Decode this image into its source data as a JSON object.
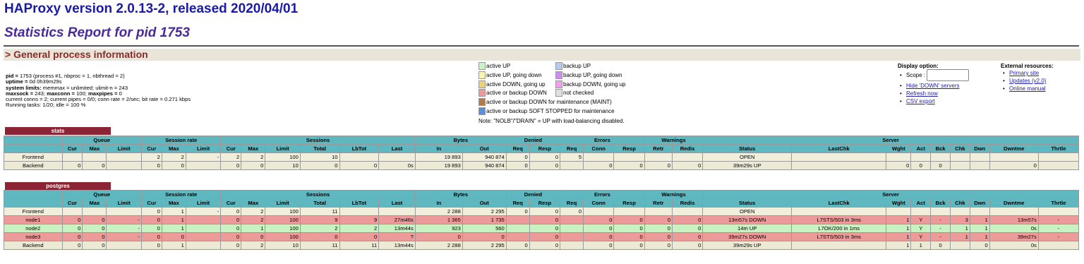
{
  "header": {
    "title": "HAProxy version 2.0.13-2, released 2020/04/01",
    "subtitle": "Statistics Report for pid 1753",
    "section": "> General process information"
  },
  "info_lines": [
    {
      "label": "pid = ",
      "text": "1753 (process #1, nbproc = 1, nbthread = 2)"
    },
    {
      "label": "uptime = ",
      "text": "0d 0h39m29s"
    },
    {
      "label": "system limits:",
      "text": " memmax = unlimited; ulimit-n = 243"
    },
    {
      "label": "maxsock = ",
      "text": "243; "
    },
    {
      "label": "",
      "text": "current conns = 2; current pipes = 0/0; conn rate = 2/sec; bit rate = 0.271 kbps"
    },
    {
      "label": "",
      "text": "Running tasks: 1/20; idle = 100 %"
    }
  ],
  "maxline": {
    "maxsock": "243",
    "maxconn_label": "maxconn = ",
    "maxconn": "100",
    "maxpipes_label": "maxpipes = ",
    "maxpipes": "0"
  },
  "legend": {
    "items": [
      {
        "label": "active UP",
        "color": "#c8f6c2"
      },
      {
        "label": "active UP, going down",
        "color": "#f6f4b3"
      },
      {
        "label": "active DOWN, going up",
        "color": "#efd07a"
      },
      {
        "label": "active or backup DOWN",
        "color": "#ec9a9a"
      },
      {
        "label": "active or backup DOWN for maintenance (MAINT)",
        "color": "#b07c4a"
      },
      {
        "label": "active or backup SOFT STOPPED for maintenance",
        "color": "#5a8fe0"
      },
      {
        "label": "backup UP",
        "color": "#b7cbf0"
      },
      {
        "label": "backup UP, going down",
        "color": "#c88ef0"
      },
      {
        "label": "backup DOWN, going up",
        "color": "#f2a0ee"
      },
      {
        "label": "not checked",
        "color": "#e0e0e0"
      }
    ],
    "note": "Note: \"NOLB\"/\"DRAIN\" = UP with load-balancing disabled."
  },
  "display_options": {
    "title": "Display option:",
    "scope_label": "Scope :",
    "links": [
      "Hide 'DOWN' servers",
      "Refresh now",
      "CSV export"
    ]
  },
  "external": {
    "title": "External resources:",
    "links": [
      "Primary site",
      "Updates (v2.0)",
      "Online manual"
    ]
  },
  "stats": {
    "name": "stats",
    "group_headers": [
      "",
      "Queue",
      "Session rate",
      "Sessions",
      "Bytes",
      "Denied",
      "Errors",
      "Warnings",
      "Server"
    ],
    "columns": [
      "",
      "Cur",
      "Max",
      "Limit",
      "Cur",
      "Max",
      "Limit",
      "Cur",
      "Max",
      "Limit",
      "Total",
      "LbTot",
      "Last",
      "In",
      "Out",
      "Req",
      "Resp",
      "Req",
      "Conn",
      "Resp",
      "Retr",
      "Redis",
      "Status",
      "LastChk",
      "Wght",
      "Act",
      "Bck",
      "Chk",
      "Dwn",
      "Dwntme",
      "Thrtle"
    ],
    "rows": [
      {
        "type": "frontend",
        "cells": [
          "Frontend",
          "",
          "",
          "",
          "2",
          "2",
          "-",
          "2",
          "2",
          "100",
          "10",
          "",
          "",
          "19 893",
          "940 874",
          "0",
          "0",
          "5",
          "",
          "",
          "",
          "",
          "OPEN",
          "",
          "",
          "",
          "",
          "",
          "",
          "",
          ""
        ]
      },
      {
        "type": "backend",
        "cells": [
          "Backend",
          "0",
          "0",
          "",
          "0",
          "0",
          "",
          "0",
          "0",
          "10",
          "0",
          "0",
          "0s",
          "19 893",
          "940 874",
          "0",
          "0",
          "",
          "0",
          "0",
          "0",
          "0",
          "39m29s UP",
          "",
          "0",
          "0",
          "0",
          "",
          "",
          "0",
          ""
        ]
      }
    ]
  },
  "postgres": {
    "name": "postgres",
    "group_headers": [
      "",
      "Queue",
      "Session rate",
      "Sessions",
      "Bytes",
      "Denied",
      "Errors",
      "Warnings",
      "Server"
    ],
    "columns": [
      "",
      "Cur",
      "Max",
      "Limit",
      "Cur",
      "Max",
      "Limit",
      "Cur",
      "Max",
      "Limit",
      "Total",
      "LbTot",
      "Last",
      "In",
      "Out",
      "Req",
      "Resp",
      "Req",
      "Conn",
      "Resp",
      "Retr",
      "Redis",
      "Status",
      "LastChk",
      "Wght",
      "Act",
      "Bck",
      "Chk",
      "Dwn",
      "Dwntme",
      "Thrtle"
    ],
    "rows": [
      {
        "type": "frontend",
        "cells": [
          "Frontend",
          "",
          "",
          "",
          "0",
          "1",
          "-",
          "0",
          "2",
          "100",
          "11",
          "",
          "",
          "2 288",
          "2 295",
          "0",
          "0",
          "0",
          "",
          "",
          "",
          "",
          "OPEN",
          "",
          "",
          "",
          "",
          "",
          "",
          "",
          ""
        ]
      },
      {
        "type": "down",
        "cells": [
          "node1",
          "0",
          "0",
          "-",
          "0",
          "1",
          "",
          "0",
          "2",
          "100",
          "9",
          "9",
          "27m46s",
          "1 365",
          "1 735",
          "",
          "0",
          "",
          "0",
          "0",
          "0",
          "0",
          "13m57s DOWN",
          "L7STS/503 in 3ms",
          "1",
          "Y",
          "-",
          "3",
          "1",
          "13m57s",
          "-"
        ]
      },
      {
        "type": "up",
        "cells": [
          "node2",
          "0",
          "0",
          "-",
          "0",
          "1",
          "",
          "0",
          "1",
          "100",
          "2",
          "2",
          "13m44s",
          "923",
          "560",
          "",
          "0",
          "",
          "0",
          "0",
          "0",
          "0",
          "14m UP",
          "L7OK/200 in 1ms",
          "1",
          "Y",
          "-",
          "1",
          "1",
          "0s",
          "-"
        ]
      },
      {
        "type": "down",
        "cells": [
          "node3",
          "0",
          "0",
          "-",
          "0",
          "0",
          "",
          "0",
          "0",
          "100",
          "0",
          "0",
          "?",
          "0",
          "0",
          "",
          "0",
          "",
          "0",
          "0",
          "0",
          "0",
          "39m27s DOWN",
          "L7STS/503 in 3ms",
          "1",
          "Y",
          "-",
          "1",
          "1",
          "39m27s",
          "-"
        ]
      },
      {
        "type": "backend",
        "cells": [
          "Backend",
          "0",
          "0",
          "",
          "0",
          "1",
          "",
          "0",
          "2",
          "10",
          "11",
          "11",
          "13m44s",
          "2 288",
          "2 295",
          "0",
          "0",
          "",
          "0",
          "0",
          "0",
          "0",
          "39m29s UP",
          "",
          "1",
          "1",
          "0",
          "",
          "0",
          "0s",
          ""
        ]
      }
    ]
  }
}
